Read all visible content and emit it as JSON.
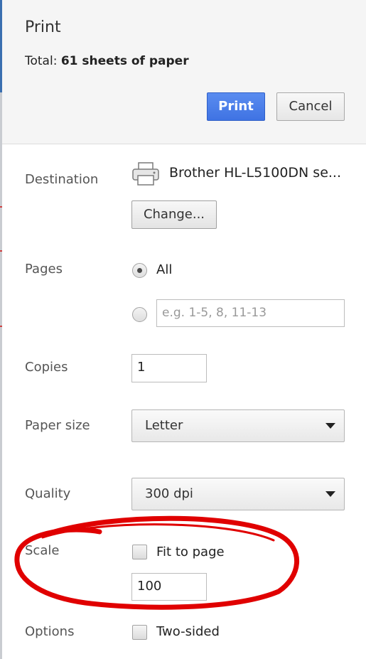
{
  "dialog": {
    "title": "Print",
    "total_label": "Total:",
    "total_value": "61 sheets of paper",
    "print_button": "Print",
    "cancel_button": "Cancel"
  },
  "destination": {
    "label": "Destination",
    "printer_name": "Brother HL-L5100DN se...",
    "change_button": "Change..."
  },
  "pages": {
    "label": "Pages",
    "all_option": "All",
    "all_selected": true,
    "custom_placeholder": "e.g. 1-5, 8, 11-13"
  },
  "copies": {
    "label": "Copies",
    "value": "1"
  },
  "paper_size": {
    "label": "Paper size",
    "selected": "Letter"
  },
  "quality": {
    "label": "Quality",
    "selected": "300 dpi"
  },
  "scale": {
    "label": "Scale",
    "fit_to_page_label": "Fit to page",
    "fit_to_page_checked": false,
    "value": "100"
  },
  "options": {
    "label": "Options",
    "two_sided_label": "Two-sided",
    "two_sided_checked": false
  },
  "annotation": {
    "color": "#e00000"
  },
  "colors": {
    "print_button": "#4a7fe9",
    "header_background": "#f5f5f5"
  }
}
